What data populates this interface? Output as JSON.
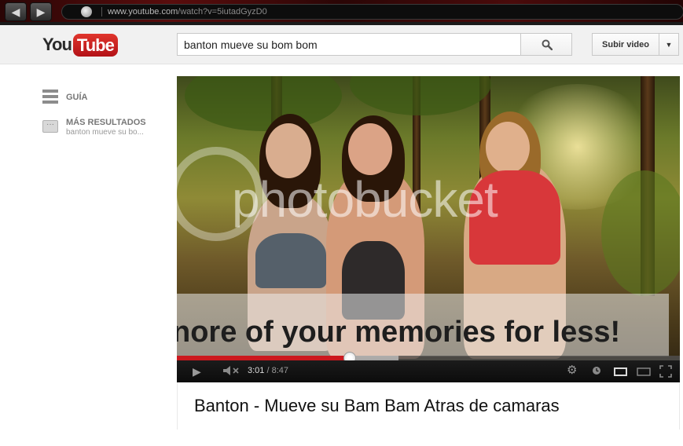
{
  "browser": {
    "url_host": "www.youtube.com",
    "url_path": "/watch?v=5iutadGyzD0",
    "back_icon": "back-arrow-icon",
    "forward_icon": "forward-arrow-icon"
  },
  "header": {
    "logo_you": "You",
    "logo_tube": "Tube",
    "search_value": "banton mueve su bom bom",
    "upload_label": "Subir video"
  },
  "sidebar": {
    "guide_label": "GUÍA",
    "more_title": "MÁS RESULTADOS",
    "more_subtitle": "banton mueve su bo..."
  },
  "video": {
    "watermark_text": "photobucket",
    "banner_text": "nore of your memories for less!",
    "time_current": "3:01",
    "time_separator": " / ",
    "time_duration": "8:47",
    "progress_fraction": 0.3434,
    "buffer_fraction": 0.44
  },
  "title": "Banton - Mueve su Bam Bam Atras de camaras",
  "colors": {
    "youtube_red": "#cc181e",
    "logo_red": "#e0352c"
  }
}
